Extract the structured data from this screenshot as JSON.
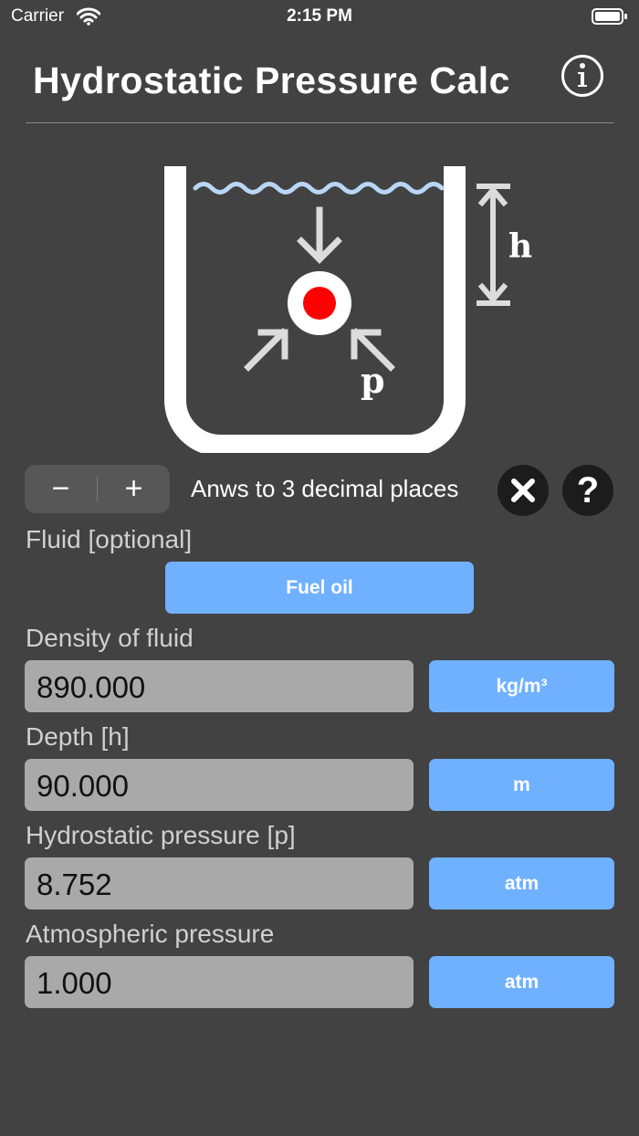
{
  "status": {
    "carrier": "Carrier",
    "time": "2:15 PM"
  },
  "header": {
    "title": "Hydrostatic Pressure Calc",
    "info_icon": "info-circle-icon"
  },
  "diagram": {
    "height_label": "h",
    "pressure_label": "p",
    "water_color": "#b8d6f5",
    "particle_color": "#ff0000"
  },
  "precision": {
    "minus_label": "−",
    "plus_label": "+",
    "text": "Anws to 3 decimal places",
    "clear_icon": "close-icon",
    "help_label": "?"
  },
  "fluid": {
    "label": "Fluid [optional]",
    "value": "Fuel oil"
  },
  "fields": [
    {
      "label": "Density of fluid",
      "value": "890.000",
      "unit": "kg/m³"
    },
    {
      "label": "Depth [h]",
      "value": "90.000",
      "unit": "m"
    },
    {
      "label": "Hydrostatic pressure [p]",
      "value": "8.752",
      "unit": "atm"
    },
    {
      "label": "Atmospheric pressure",
      "value": "1.000",
      "unit": "atm"
    }
  ],
  "colors": {
    "background": "#424242",
    "accent": "#6fb1ff",
    "field": "#a9a9a9"
  }
}
